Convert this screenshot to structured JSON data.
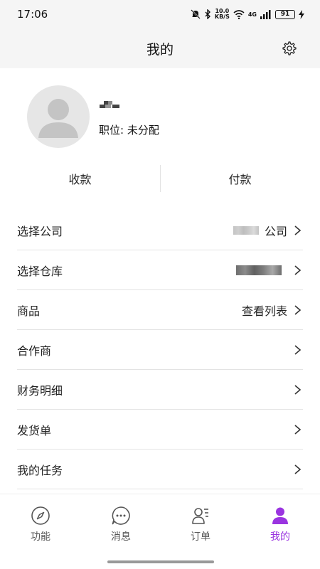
{
  "status_bar": {
    "time": "17:06",
    "speed_top": "10.0",
    "speed_unit": "KB/S",
    "network": "4G",
    "battery": "91"
  },
  "header": {
    "title": "我的"
  },
  "profile": {
    "position_label": "职位: 未分配"
  },
  "payments": {
    "receive": "收款",
    "pay": "付款"
  },
  "menu": {
    "items": [
      {
        "label": "选择公司",
        "value": "公司"
      },
      {
        "label": "选择仓库",
        "value": ""
      },
      {
        "label": "商品",
        "value": "查看列表"
      },
      {
        "label": "合作商",
        "value": ""
      },
      {
        "label": "财务明细",
        "value": ""
      },
      {
        "label": "发货单",
        "value": ""
      },
      {
        "label": "我的任务",
        "value": ""
      }
    ]
  },
  "tabbar": {
    "active_color": "#9a34e0",
    "tabs": [
      {
        "label": "功能",
        "icon": "compass-icon"
      },
      {
        "label": "消息",
        "icon": "chat-icon"
      },
      {
        "label": "订单",
        "icon": "order-list-icon"
      },
      {
        "label": "我的",
        "icon": "person-icon"
      }
    ]
  }
}
